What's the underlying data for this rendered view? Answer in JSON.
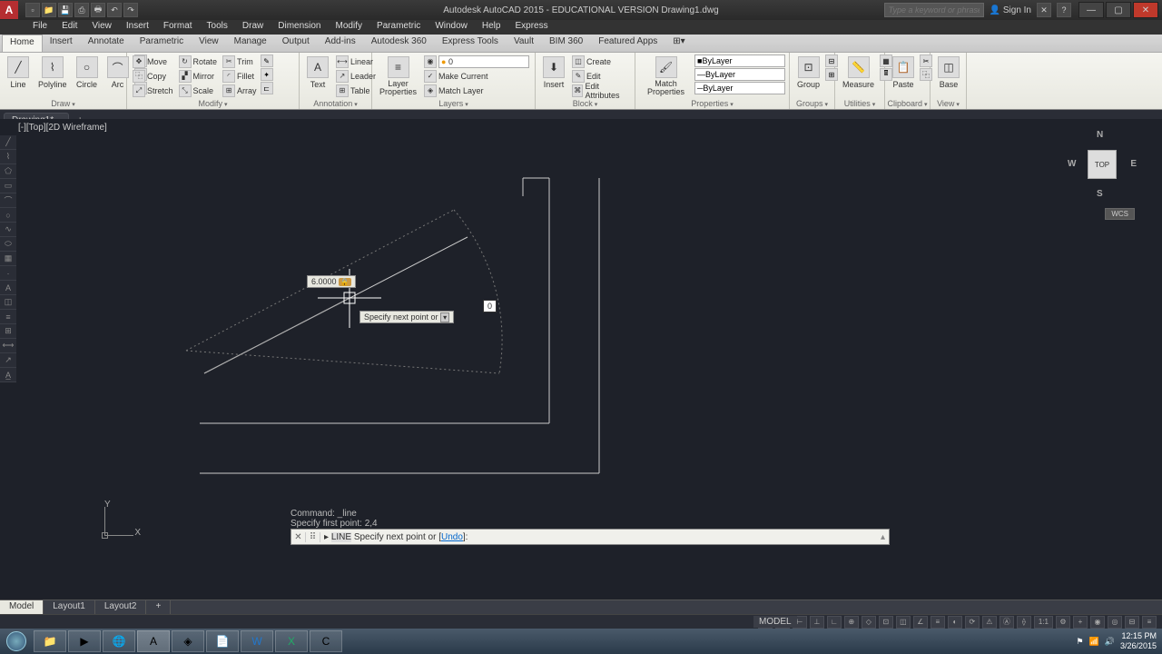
{
  "title": "Autodesk AutoCAD 2015 - EDUCATIONAL VERSION   Drawing1.dwg",
  "search_placeholder": "Type a keyword or phrase",
  "sign_in": "Sign In",
  "menus": [
    "File",
    "Edit",
    "View",
    "Insert",
    "Format",
    "Tools",
    "Draw",
    "Dimension",
    "Modify",
    "Parametric",
    "Window",
    "Help",
    "Express"
  ],
  "ribbon_tabs": [
    "Home",
    "Insert",
    "Annotate",
    "Parametric",
    "View",
    "Manage",
    "Output",
    "Add-ins",
    "Autodesk 360",
    "Express Tools",
    "Vault",
    "BIM 360",
    "Featured Apps"
  ],
  "active_ribbon_tab": 0,
  "ribbon_groups": {
    "draw": {
      "label": "Draw",
      "line": "Line",
      "polyline": "Polyline",
      "circle": "Circle",
      "arc": "Arc"
    },
    "modify": {
      "label": "Modify",
      "move": "Move",
      "rotate": "Rotate",
      "trim": "Trim",
      "copy": "Copy",
      "mirror": "Mirror",
      "fillet": "Fillet",
      "stretch": "Stretch",
      "scale": "Scale",
      "array": "Array"
    },
    "annotation": {
      "label": "Annotation",
      "text": "Text",
      "linear": "Linear",
      "leader": "Leader",
      "table": "Table"
    },
    "layers": {
      "label": "Layers",
      "props": "Layer\nProperties",
      "make_current": "Make Current",
      "match_layer": "Match Layer",
      "current": "0"
    },
    "block": {
      "label": "Block",
      "insert": "Insert",
      "create": "Create",
      "edit": "Edit",
      "edit_attr": "Edit Attributes"
    },
    "properties": {
      "label": "Properties",
      "match": "Match\nProperties",
      "bylayer": "ByLayer",
      "bylayer2": "ByLayer",
      "bylayer3": "ByLayer"
    },
    "groups": {
      "label": "Groups",
      "group": "Group"
    },
    "utilities": {
      "label": "Utilities",
      "measure": "Measure"
    },
    "clipboard": {
      "label": "Clipboard",
      "paste": "Paste"
    },
    "view": {
      "label": "View",
      "base": "Base"
    }
  },
  "doc_tab": "Drawing1*",
  "viewport_label": "[-][Top][2D Wireframe]",
  "dyn_length": "6.0000",
  "dyn_angle": "0",
  "dyn_prompt": "Specify next point or",
  "cmd_history_1": "Command: _line",
  "cmd_history_2": "Specify first point: 2,4",
  "cmd_current_cmd": "LINE",
  "cmd_current_text": " Specify next point or [",
  "cmd_undo": "Undo",
  "cmd_close_bracket": "]:",
  "viewcube_face": "TOP",
  "viewcube_wcs": "WCS",
  "layout_tabs": [
    "Model",
    "Layout1",
    "Layout2"
  ],
  "status_model": "MODEL",
  "status_scale": "1:1",
  "tray_time": "12:15 PM",
  "tray_date": "3/26/2015"
}
